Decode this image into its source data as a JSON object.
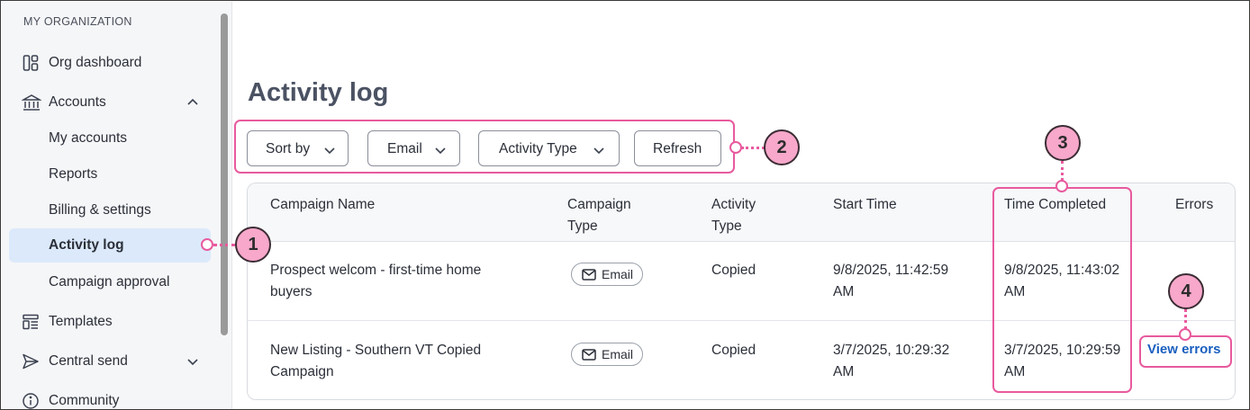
{
  "sidebar": {
    "heading": "MY ORGANIZATION",
    "items": [
      {
        "label": "Org dashboard",
        "icon": "grid-icon"
      },
      {
        "label": "Accounts",
        "icon": "bank-icon",
        "chevron": "chevron-up-icon"
      },
      {
        "label": "My accounts"
      },
      {
        "label": "Reports"
      },
      {
        "label": "Billing & settings"
      },
      {
        "label": "Activity log",
        "active": true
      },
      {
        "label": "Campaign approval"
      },
      {
        "label": "Templates",
        "icon": "template-icon"
      },
      {
        "label": "Central send",
        "icon": "send-icon",
        "chevron": "chevron-down-icon"
      },
      {
        "label": "Community",
        "icon": "info-icon"
      }
    ]
  },
  "main": {
    "title": "Activity log",
    "filters": {
      "sort_by": "Sort by",
      "email": "Email",
      "activity_type": "Activity Type",
      "refresh": "Refresh"
    },
    "table": {
      "columns": {
        "campaign_name": "Campaign Name",
        "campaign_type_1": "Campaign",
        "campaign_type_2": "Type",
        "activity_type_1": "Activity",
        "activity_type_2": "Type",
        "start_time": "Start Time",
        "time_completed": "Time Completed",
        "errors": "Errors"
      },
      "rows": [
        {
          "name_1": "Prospect welcom - first-time home",
          "name_2": "buyers",
          "type": "Email",
          "activity": "Copied",
          "start_1": "9/8/2025, 11:42:59",
          "start_2": "AM",
          "completed_1": "9/8/2025, 11:43:02",
          "completed_2": "AM",
          "errors": ""
        },
        {
          "name_1": "New Listing - Southern VT Copied",
          "name_2": "Campaign",
          "type": "Email",
          "activity": "Copied",
          "start_1": "3/7/2025, 10:29:32",
          "start_2": "AM",
          "completed_1": "3/7/2025, 10:29:59",
          "completed_2": "AM",
          "errors": "View errors"
        }
      ]
    }
  },
  "callouts": [
    "1",
    "2",
    "3",
    "4"
  ],
  "colors": {
    "accent_pink": "#e85a9e",
    "badge_fill": "#f7a8cb",
    "active_bg": "#dbe9fb",
    "link_blue": "#1a5fbf"
  }
}
